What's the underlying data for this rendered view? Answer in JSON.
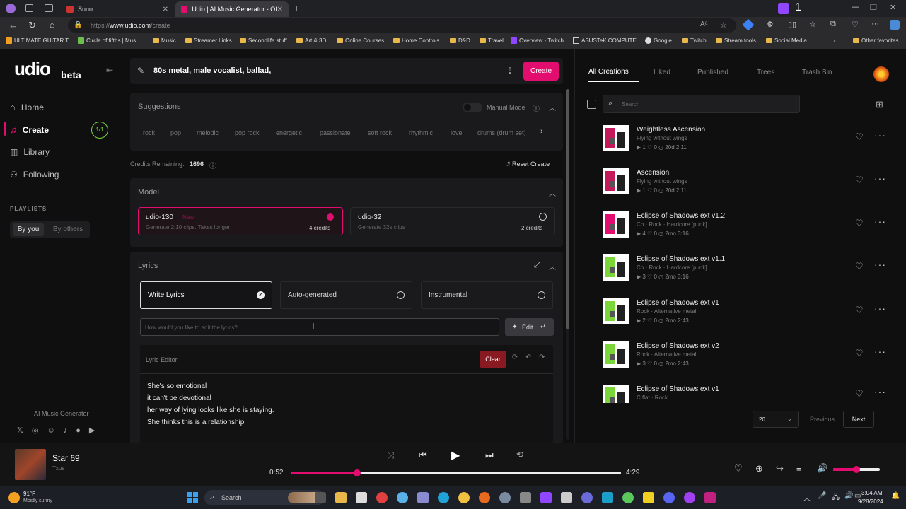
{
  "browser": {
    "tabs": [
      {
        "label": "Suno"
      },
      {
        "label": "Udio | AI Music Generator - Offic"
      }
    ],
    "url_prefix": "https://",
    "url_main": "www.udio.com",
    "url_path": "/create",
    "bookmarks": [
      "ULTIMATE GUITAR T...",
      "Circle of fifths | Mus...",
      "Music",
      "Streamer Links",
      "Secondlife stuff",
      "Art & 3D",
      "Online Courses",
      "Home Controls",
      "D&D",
      "Travel",
      "Overview - Twitch",
      "ASUSTeK COMPUTE...",
      "Google",
      "Twitch",
      "Stream tools",
      "Social Media",
      "Other favorites"
    ],
    "twitch_count": "1"
  },
  "sidebar": {
    "logo": "udio",
    "logo_tag": "beta",
    "nav": [
      {
        "label": "Home"
      },
      {
        "label": "Create"
      },
      {
        "label": "Library"
      },
      {
        "label": "Following"
      }
    ],
    "create_badge": "1/1",
    "playlists_heading": "PLAYLISTS",
    "by_you": "By you",
    "by_others": "By others",
    "footer": "AI Music Generator"
  },
  "prompt": {
    "text": "80s metal, male vocalist, ballad,",
    "create_label": "Create"
  },
  "suggestions": {
    "title": "Suggestions",
    "manual_mode": "Manual Mode",
    "chips": [
      "rock",
      "pop",
      "melodic",
      "pop rock",
      "energetic",
      "passionate",
      "soft rock",
      "rhythmic",
      "love",
      "drums (drum set)"
    ]
  },
  "credits": {
    "label": "Credits Remaining:",
    "value": "1696",
    "reset": "Reset Create"
  },
  "model": {
    "title": "Model",
    "options": [
      {
        "name": "udio-130",
        "tag": "New",
        "desc": "Generate 2:10 clips. Takes longer",
        "credits": "4 credits"
      },
      {
        "name": "udio-32",
        "tag": "",
        "desc": "Generate 32s clips",
        "credits": "2 credits"
      }
    ]
  },
  "lyrics": {
    "title": "Lyrics",
    "modes": [
      "Write Lyrics",
      "Auto-generated",
      "Instrumental"
    ],
    "edit_placeholder": "How would you like to edit the lyrics?",
    "edit_label": "Edit",
    "editor_title": "Lyric Editor",
    "clear_label": "Clear",
    "lines": [
      "She's so emotional",
      "it can't be devotional",
      "her way of lying looks like she is staying.",
      "She thinks this is a relationship"
    ]
  },
  "library": {
    "tabs": [
      "All Creations",
      "Liked",
      "Published",
      "Trees",
      "Trash Bin"
    ],
    "search_placeholder": "Search",
    "songs": [
      {
        "title": "Weightless Ascension",
        "sub": "Flying without wings",
        "meta": "▶ 1   ♡ 0   ◷ 20d  2:11",
        "theme": "#c41a5c"
      },
      {
        "title": "Ascension",
        "sub": "Flying without wings",
        "meta": "▶ 1   ♡ 0   ◷ 20d  2:11",
        "theme": "#c41a5c"
      },
      {
        "title": "Eclipse of Shadows ext v1.2",
        "sub": "Cb  ·  Rock  ·  Hardcore [punk]",
        "meta": "▶ 4   ♡ 0   ◷ 2mo  3:16",
        "theme": "#e30c6f"
      },
      {
        "title": "Eclipse of Shadows ext v1.1",
        "sub": "Cb  ·  Rock  ·  Hardcore [punk]",
        "meta": "▶ 3   ♡ 0   ◷ 2mo  3:16",
        "theme": "#7bd63a"
      },
      {
        "title": "Eclipse of Shadows ext v1",
        "sub": "Rock  ·  Alternative metal",
        "meta": "▶ 2   ♡ 0   ◷ 2mo  2:43",
        "theme": "#7bd63a"
      },
      {
        "title": "Eclipse of Shadows ext v2",
        "sub": "Rock  ·  Alternative metal",
        "meta": "▶ 3   ♡ 0   ◷ 2mo  2:43",
        "theme": "#7bd63a"
      },
      {
        "title": "Eclipse of Shadows ext v1",
        "sub": "C flat  ·  Rock",
        "meta": "",
        "theme": "#7bd63a"
      }
    ],
    "page_size": "20",
    "previous": "Previous",
    "next": "Next"
  },
  "player": {
    "title": "Star 69",
    "artist": "Txus",
    "current": "0:52",
    "total": "4:29",
    "progress": 0.2,
    "volume": 0.5
  },
  "taskbar": {
    "weather_temp": "91°F",
    "weather_desc": "Mostly sunny",
    "search": "Search",
    "time": "3:04 AM",
    "date": "9/28/2024"
  },
  "colors": {
    "accent": "#e30c6f",
    "green": "#7bd63a",
    "bg": "#0f0f10",
    "panel": "#1a1a1c"
  }
}
